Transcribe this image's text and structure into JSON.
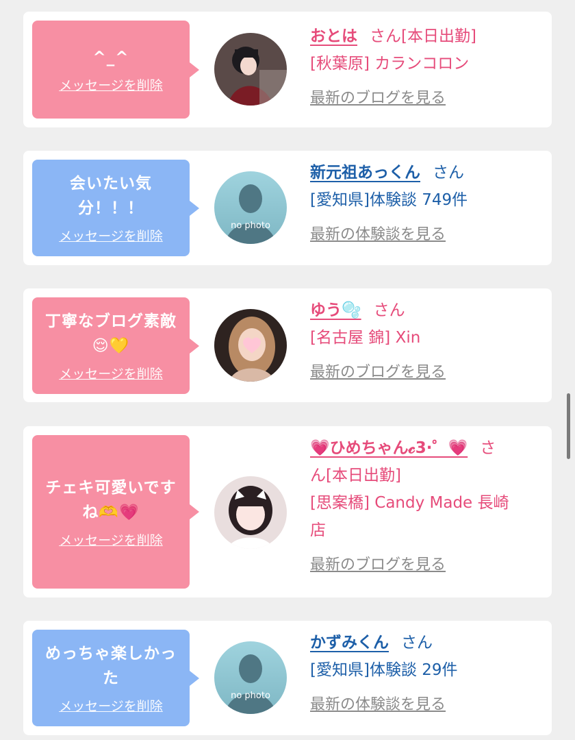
{
  "cards": [
    {
      "color": "pink",
      "message": "^_^",
      "delete_label": "メッセージを削除",
      "name": "おとは",
      "honorific": "さん",
      "line1_suffix": "[本日出勤]",
      "line2": "[秋葉原] カランコロン",
      "link": "最新のブログを見る"
    },
    {
      "color": "blue",
      "message": "会いたい気分！！！",
      "delete_label": "メッセージを削除",
      "name": "新元祖あっくん",
      "honorific": "さん",
      "line2": "[愛知県]体験談 749件",
      "link": "最新の体験談を見る",
      "avatar_text": "no photo"
    },
    {
      "color": "pink",
      "message": "丁寧なブログ素敵😌💛",
      "delete_label": "メッセージを削除",
      "name": "ゆう🫧",
      "honorific": "さん",
      "line2": "[名古屋 錦] Xin",
      "link": "最新のブログを見る"
    },
    {
      "color": "pink",
      "message": "チェキ可愛いですね🫶💗",
      "delete_label": "メッセージを削除",
      "name": "💗ひめちゃん𝓬3·゜💗",
      "honorific": "さ",
      "line1_cont": "ん[本日出勤]",
      "line2": "[思案橋] Candy Made 長崎",
      "line3": "店",
      "link": "最新のブログを見る"
    },
    {
      "color": "blue",
      "message": "めっちゃ楽しかった",
      "delete_label": "メッセージを削除",
      "name": "かずみくん",
      "honorific": "さん",
      "line2": "[愛知県]体験談 29件",
      "link": "最新の体験談を見る",
      "avatar_text": "no photo"
    }
  ],
  "colors": {
    "pink_bubble": "#f78fa3",
    "blue_bubble": "#8bb6f5",
    "pink_text": "#e64b7a",
    "blue_text": "#1d5fa8",
    "link_gray": "#8a8a8a",
    "page_bg": "#efefef"
  }
}
